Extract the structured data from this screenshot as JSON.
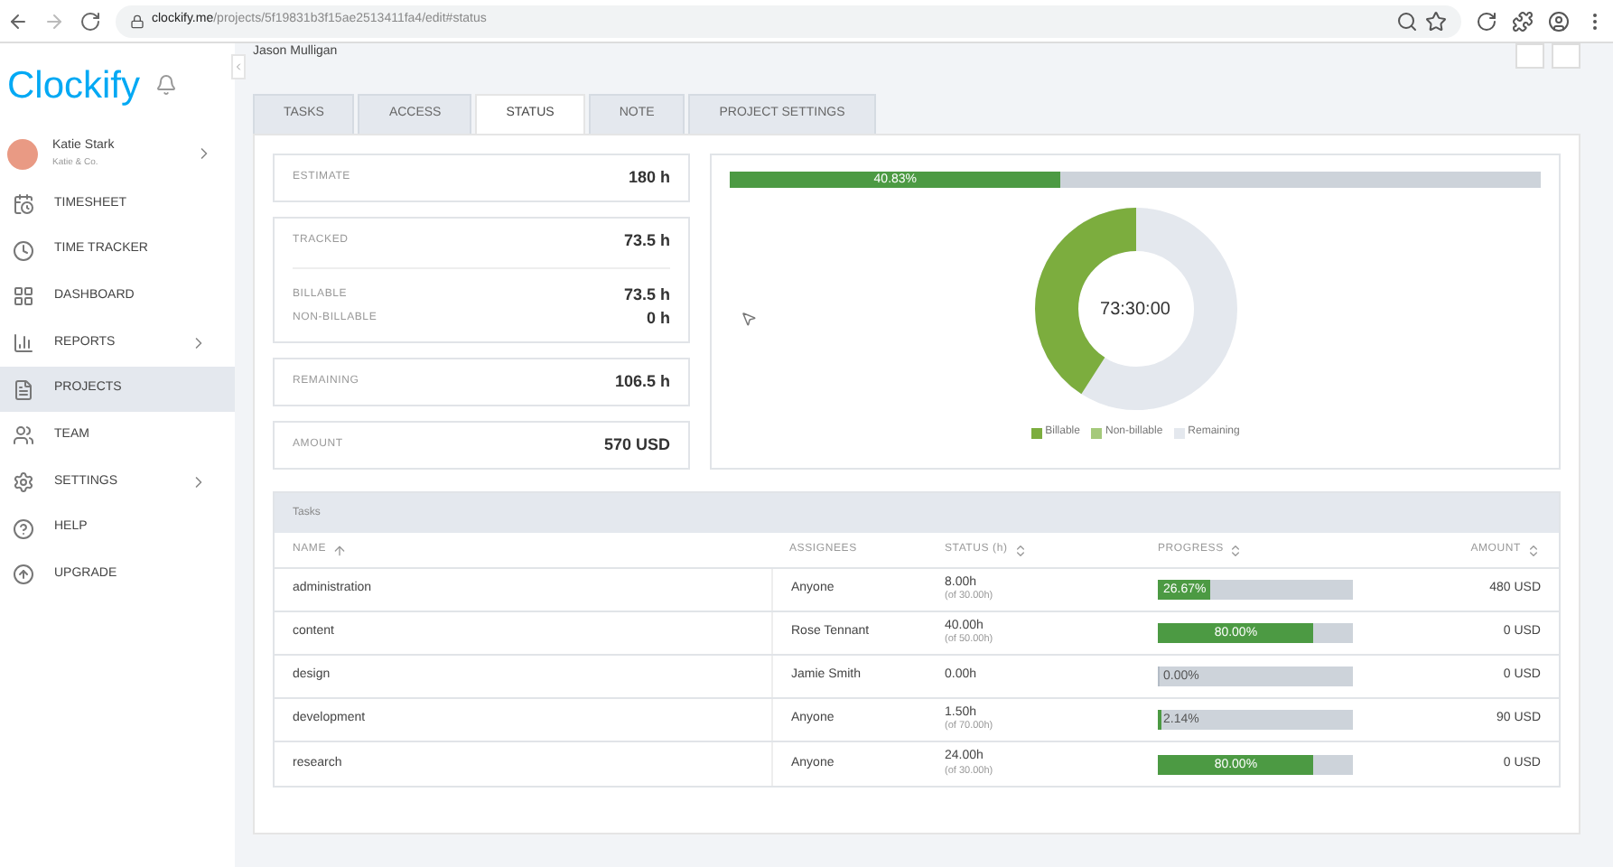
{
  "browser": {
    "url_host": "clockify.me",
    "url_path": "/projects/5f19831b3f15ae2513411fa4/edit#status"
  },
  "sidebar": {
    "logo": "Clockify",
    "user": {
      "name": "Katie Stark",
      "workspace": "Katie & Co."
    },
    "items": [
      {
        "label": "TIMESHEET",
        "kind": "timesheet",
        "selected": false,
        "submenu": false
      },
      {
        "label": "TIME TRACKER",
        "kind": "clock",
        "selected": false,
        "submenu": false
      },
      {
        "label": "DASHBOARD",
        "kind": "grid",
        "selected": false,
        "submenu": false
      },
      {
        "label": "REPORTS",
        "kind": "chart",
        "selected": false,
        "submenu": true
      },
      {
        "label": "PROJECTS",
        "kind": "file",
        "selected": true,
        "submenu": false
      },
      {
        "label": "TEAM",
        "kind": "team",
        "selected": false,
        "submenu": false
      },
      {
        "label": "SETTINGS",
        "kind": "gear",
        "selected": false,
        "submenu": true
      },
      {
        "label": "HELP",
        "kind": "help",
        "selected": false,
        "submenu": false
      },
      {
        "label": "UPGRADE",
        "kind": "upgrade",
        "selected": false,
        "submenu": false
      }
    ]
  },
  "header": {
    "client": "Jason Mulligan"
  },
  "tabs": [
    {
      "label": "TASKS",
      "selected": false
    },
    {
      "label": "ACCESS",
      "selected": false
    },
    {
      "label": "STATUS",
      "selected": true
    },
    {
      "label": "NOTE",
      "selected": false
    },
    {
      "label": "PROJECT SETTINGS",
      "selected": false
    }
  ],
  "stats": [
    {
      "rows": [
        {
          "label": "ESTIMATE",
          "value": "180 h"
        }
      ]
    },
    {
      "rows": [
        {
          "label": "TRACKED",
          "value": "73.5 h"
        }
      ],
      "sub_rows": [
        {
          "label": "BILLABLE",
          "value": "73.5 h"
        },
        {
          "label": "NON-BILLABLE",
          "value": "0 h"
        }
      ]
    },
    {
      "rows": [
        {
          "label": "REMAINING",
          "value": "106.5 h"
        }
      ]
    },
    {
      "rows": [
        {
          "label": "AMOUNT",
          "value": "570 USD"
        }
      ]
    }
  ],
  "overview": {
    "progress": {
      "level": 0.4083,
      "label": "40.83%"
    },
    "donut": {
      "center": "73:30:00"
    },
    "legend": [
      {
        "label": "Billable",
        "color": "#7cad3e"
      },
      {
        "label": "Non-billable",
        "color": "#a5c97b"
      },
      {
        "label": "Remaining",
        "color": "#e4e8ee"
      }
    ]
  },
  "tasks": {
    "title": "Tasks",
    "columns": [
      {
        "label": "NAME",
        "kind": "asc"
      },
      {
        "label": "ASSIGNEES",
        "kind": "none"
      },
      {
        "label": "STATUS (h)",
        "kind": "both"
      },
      {
        "label": "PROGRESS",
        "kind": "both"
      },
      {
        "label": "AMOUNT",
        "kind": "both"
      }
    ],
    "rows": [
      {
        "name": "administration",
        "assignee": "Anyone",
        "hours": "8.00h",
        "of": "(of 30.00h)",
        "progress": {
          "level": 0.2667,
          "label": "26.67%"
        },
        "amount": "480 USD"
      },
      {
        "name": "content",
        "assignee": "Rose Tennant",
        "hours": "40.00h",
        "of": "(of 50.00h)",
        "progress": {
          "level": 0.8,
          "label": "80.00%"
        },
        "amount": "0 USD"
      },
      {
        "name": "design",
        "assignee": "Jamie Smith",
        "hours": "0.00h",
        "progress": {
          "level": 0,
          "label": "0.00%"
        },
        "amount": "0 USD"
      },
      {
        "name": "development",
        "assignee": "Anyone",
        "hours": "1.50h",
        "of": "(of 70.00h)",
        "progress": {
          "level": 0.0214,
          "label": "2.14%"
        },
        "amount": "90 USD"
      },
      {
        "name": "research",
        "assignee": "Anyone",
        "hours": "24.00h",
        "of": "(of 30.00h)",
        "progress": {
          "level": 0.8,
          "label": "80.00%"
        },
        "amount": "0 USD"
      }
    ]
  }
}
